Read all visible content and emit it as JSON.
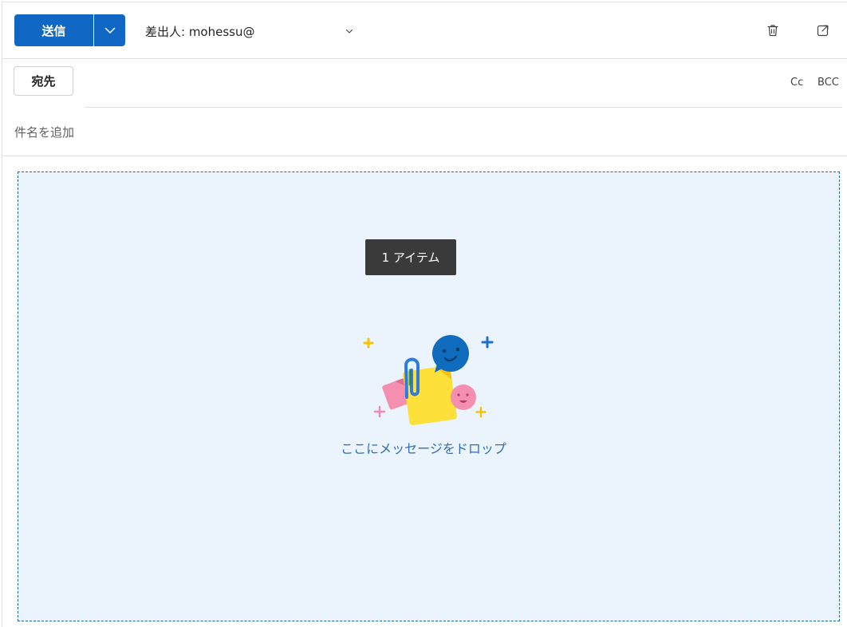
{
  "toolbar": {
    "send_label": "送信",
    "from_label": "差出人: mohessu@",
    "send_options_icon": "chevron-down-icon",
    "delete_icon": "trash-icon",
    "popout_icon": "pop-out-icon"
  },
  "recipients": {
    "to_label": "宛先",
    "cc_label": "Cc",
    "bcc_label": "BCC"
  },
  "subject": {
    "placeholder": "件名を追加"
  },
  "dropzone": {
    "tooltip": "1 アイテム",
    "message": "ここにメッセージをドロップ"
  },
  "colors": {
    "accent": "#1168c4",
    "dropzone_bg": "#ebf3fc",
    "dropzone_border": "#1e6aa8",
    "tooltip_bg": "#3a3a3a"
  }
}
